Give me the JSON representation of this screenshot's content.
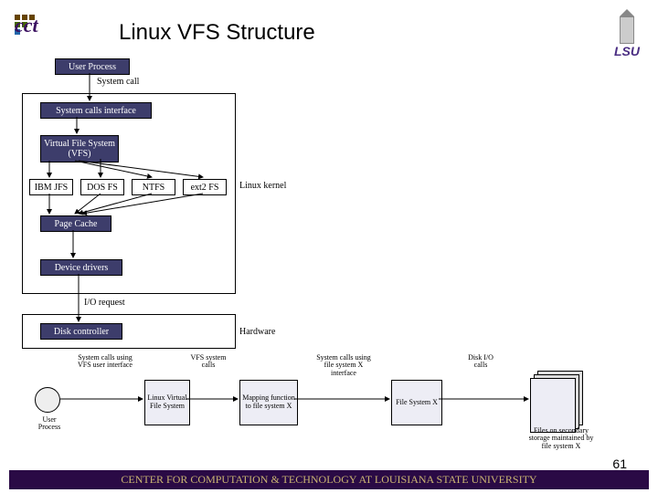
{
  "header": {
    "title": "Linux VFS Structure",
    "lsu_label": "LSU"
  },
  "main": {
    "user_process": "User Process",
    "system_call": "System call",
    "sci": "System calls interface",
    "vfs": "Virtual File System (VFS)",
    "fs": {
      "a": "IBM JFS",
      "b": "DOS FS",
      "c": "NTFS",
      "d": "ext2 FS"
    },
    "page_cache": "Page Cache",
    "device_drivers": "Device drivers",
    "io_request": "I/O request",
    "disk_controller": "Disk controller",
    "linux_kernel": "Linux kernel",
    "hardware": "Hardware"
  },
  "bottom": {
    "user_process": "User Process",
    "lbl_syscall_vfs": "System calls using VFS user interface",
    "lbl_vfs_calls": "VFS system calls",
    "lbl_syscall_fsx": "System calls using file system X interface",
    "lbl_disk_io": "Disk I/O calls",
    "lvfs": "Linux Virtual File System",
    "mapfn": "Mapping function to file system X",
    "fsx": "File System X",
    "files_box": "Files on secondary storage maintained by file system X"
  },
  "footer": {
    "text": "CENTER FOR COMPUTATION & TECHNOLOGY AT LOUISIANA STATE UNIVERSITY",
    "page": "61"
  }
}
